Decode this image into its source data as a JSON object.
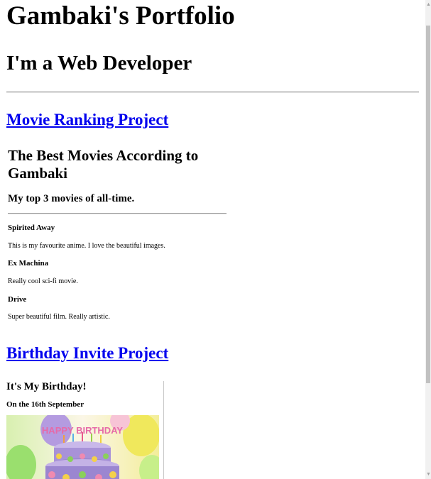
{
  "header": {
    "name": "Gambaki's Portfolio",
    "role": "I'm a Web Developer"
  },
  "projects": [
    {
      "label": "Movie Ranking Project"
    },
    {
      "label": "Birthday Invite Project"
    }
  ],
  "movie_page": {
    "title": "The Best Movies According to Gambaki",
    "subtitle": "My top 3 movies of all-time.",
    "movies": [
      {
        "name": "Spirited Away",
        "description": "This is my favourite anime. I love the beautiful images."
      },
      {
        "name": "Ex Machina",
        "description": "Really cool sci-fi movie."
      },
      {
        "name": "Drive",
        "description": "Super beautiful film. Really artistic."
      }
    ]
  },
  "birthday_page": {
    "title": "It's My Birthday!",
    "date": "On the 16th September",
    "image_text": "HAPPY BIRTHDAY"
  },
  "scrollbar": {
    "up_arrow": "▲",
    "down_arrow": "▼"
  }
}
